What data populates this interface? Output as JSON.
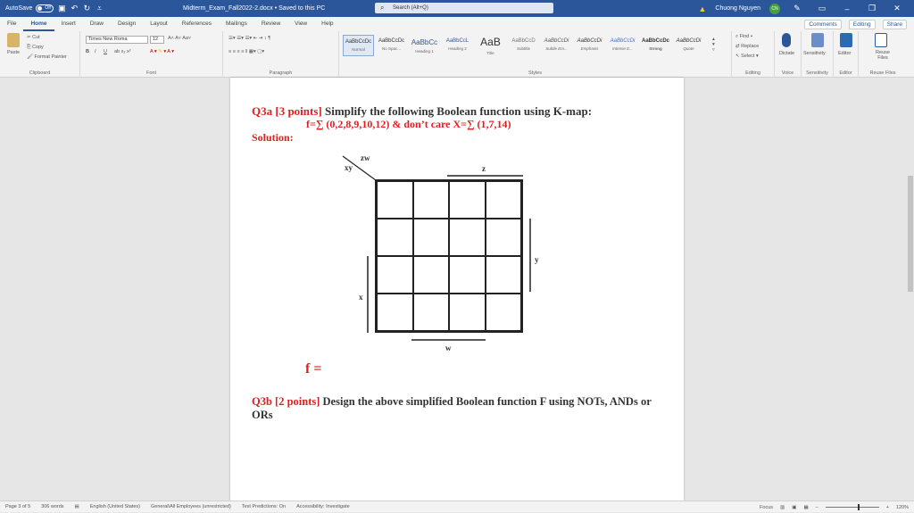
{
  "titlebar": {
    "autosave": "AutoSave",
    "autosave_state": "Off",
    "doc_title": "Midterm_Exam_Fall2022-2.docx  •  Saved to this PC",
    "search_placeholder": "Search (Alt+Q)",
    "user": "Chuong Nguyen",
    "initials": "CN"
  },
  "tabs": [
    "File",
    "Home",
    "Insert",
    "Draw",
    "Design",
    "Layout",
    "References",
    "Mailings",
    "Review",
    "View",
    "Help"
  ],
  "active_tab": "Home",
  "actions": {
    "comments": "Comments",
    "editing": "Editing",
    "share": "Share"
  },
  "ribbon": {
    "clipboard": {
      "paste": "Paste",
      "cut": "Cut",
      "copy": "Copy",
      "format_painter": "Format Painter",
      "label": "Clipboard"
    },
    "font": {
      "name": "Times New Roma",
      "size": "12",
      "label": "Font"
    },
    "paragraph": {
      "label": "Paragraph"
    },
    "styles": {
      "label": "Styles",
      "items": [
        {
          "preview": "AaBbCcDc",
          "name": "Normal"
        },
        {
          "preview": "AaBbCcDc",
          "name": "No Spac..."
        },
        {
          "preview": "AaBbCc",
          "name": "Heading 1"
        },
        {
          "preview": "AaBbCcL",
          "name": "Heading 2"
        },
        {
          "preview": "AaB",
          "name": "Title"
        },
        {
          "preview": "AaBbCcD",
          "name": "Subtitle"
        },
        {
          "preview": "AaBbCcDi",
          "name": "Subtle Em..."
        },
        {
          "preview": "AaBbCcDi",
          "name": "Emphasis"
        },
        {
          "preview": "AaBbCcDi",
          "name": "Intense E..."
        },
        {
          "preview": "AaBbCcDc",
          "name": "Strong"
        },
        {
          "preview": "AaBbCcDi",
          "name": "Quote"
        }
      ]
    },
    "editing": {
      "find": "Find",
      "replace": "Replace",
      "select": "Select",
      "label": "Editing"
    },
    "voice": {
      "dictate": "Dictate",
      "label": "Voice"
    },
    "sensitivity": {
      "btn": "Sensitivity",
      "label": "Sensitivity"
    },
    "editor": {
      "btn": "Editor",
      "label": "Editor"
    },
    "reuse": {
      "btn": "Reuse Files",
      "label": "Reuse Files"
    }
  },
  "document": {
    "q3a_label": "Q3a [3 points]",
    "q3a_text": " Simplify the following Boolean function using K-map:",
    "formula": "f=∑ (0,2,8,9,10,12) & don’t care X=∑ (1,7,14)",
    "solution": "Solution:",
    "kmap": {
      "zw": "zw",
      "xy": "xy",
      "z": "z",
      "y": "y",
      "x": "x",
      "w": "w"
    },
    "f_eq": "f =",
    "q3b_label": "Q3b [2 points]",
    "q3b_text": " Design the above simplified Boolean function F using NOTs, ANDs or ORs"
  },
  "status": {
    "page": "Page 3 of 5",
    "words": "306 words",
    "language": "English (United States)",
    "label": "General\\All Employees (unrestricted)",
    "predictions": "Text Predictions: On",
    "accessibility": "Accessibility: Investigate",
    "focus": "Focus",
    "zoom": "120%"
  }
}
